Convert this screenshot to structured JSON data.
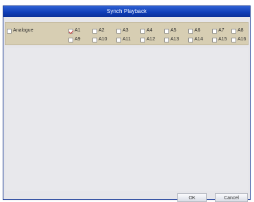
{
  "dialog": {
    "title": "Synch Playback"
  },
  "channels": {
    "analogue": {
      "label": "Analogue",
      "checked": false
    },
    "items": [
      {
        "label": "A1",
        "checked": true
      },
      {
        "label": "A2",
        "checked": false
      },
      {
        "label": "A3",
        "checked": false
      },
      {
        "label": "A4",
        "checked": false
      },
      {
        "label": "A5",
        "checked": false
      },
      {
        "label": "A6",
        "checked": false
      },
      {
        "label": "A7",
        "checked": false
      },
      {
        "label": "A8",
        "checked": false
      },
      {
        "label": "A9",
        "checked": false
      },
      {
        "label": "A10",
        "checked": false
      },
      {
        "label": "A11",
        "checked": false
      },
      {
        "label": "A12",
        "checked": false
      },
      {
        "label": "A13",
        "checked": false
      },
      {
        "label": "A14",
        "checked": false
      },
      {
        "label": "A15",
        "checked": false
      },
      {
        "label": "A16",
        "checked": false
      }
    ]
  },
  "buttons": {
    "ok": "OK",
    "cancel": "Cancel"
  },
  "colors": {
    "titlebar": "#0f3eb9",
    "panel": "#d7ceb3",
    "content": "#e8e8ec",
    "check_mark": "#c0322e"
  }
}
